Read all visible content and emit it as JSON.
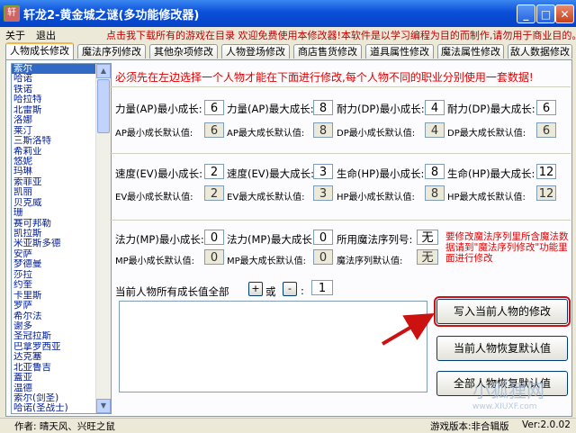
{
  "window": {
    "title": "轩龙2-黄金城之谜(多功能修改器)",
    "app_icon": "轩"
  },
  "menu": {
    "items": [
      "关于",
      "退出"
    ],
    "marquee": "点击我下载所有的游戏在目录 欢迎免费使用本修改器!本软件是以学习编程为目的而制作,请勿用于商业目的。"
  },
  "tabs": [
    "人物成长修改",
    "魔法序列修改",
    "其他杂项修改",
    "人物登场修改",
    "商店售货修改",
    "道具属性修改",
    "魔法属性修改",
    "敌人数据修改"
  ],
  "characters": [
    "索尔",
    "哈诺",
    "铁诺",
    "哈拉特",
    "北雷斯",
    "洛娜",
    "莱汀",
    "三斯洛特",
    "希莉业",
    "悠妮",
    "玛琳",
    "索菲亚",
    "凯丽",
    "贝克威",
    "珊",
    "赛可邦勒",
    "凯拉斯",
    "米亚斯多德",
    "安萨",
    "梦德曼",
    "莎拉",
    "约奎",
    "卡里斯",
    "罗萨",
    "希尔法",
    "谢多",
    "圣冠拉斯",
    "巴拿罗西亚",
    "达克塞",
    "北亚鲁吉",
    "蓋亚",
    "温德",
    "索尔(剑圣)",
    "哈诺(圣战士)"
  ],
  "notice": "必须先在左边选择一个人物才能在下面进行修改,每个人物不同的职业分别使用一套数据!",
  "strength": {
    "min_label": "力量(AP)最小成长:",
    "min": "6",
    "max_label": "力量(AP)最大成长:",
    "max": "8",
    "dmin_label": "耐力(DP)最小成长:",
    "dmin": "4",
    "dmax_label": "耐力(DP)最大成长:",
    "dmax": "6",
    "def_min_label": "AP最小成长默认值:",
    "def_min": "6",
    "def_max_label": "AP最大成长默认值:",
    "def_max": "8",
    "def_dmin_label": "DP最小成长默认值:",
    "def_dmin": "4",
    "def_dmax_label": "DP最大成长默认值:",
    "def_dmax": "6"
  },
  "speed": {
    "min_label": "速度(EV)最小成长:",
    "min": "2",
    "max_label": "速度(EV)最大成长:",
    "max": "3",
    "hmin_label": "生命(HP)最小成长:",
    "hmin": "8",
    "hmax_label": "生命(HP)最大成长:",
    "hmax": "12",
    "def_min_label": "EV最小成长默认值:",
    "def_min": "2",
    "def_max_label": "EV最大成长默认值:",
    "def_max": "3",
    "def_hmin_label": "HP最小成长默认值:",
    "def_hmin": "8",
    "def_hmax_label": "HP最大成长默认值:",
    "def_hmax": "12"
  },
  "magic": {
    "min_label": "法力(MP)最小成长:",
    "min": "0",
    "max_label": "法力(MP)最大成长:",
    "max": "0",
    "seq_label": "所用魔法序列号:",
    "seq": "无",
    "def_min_label": "MP最小成长默认值:",
    "def_min": "0",
    "def_max_label": "MP最大成长默认值:",
    "def_max": "0",
    "def_seq_label": "魔法序列默认值:",
    "def_seq": "无",
    "warning": "要修改魔法序列里所含魔法数据请到\"魔法序列修改\"功能里面进行修改"
  },
  "all": {
    "label": "当前人物所有成长值全部",
    "plus": "+",
    "or": "或",
    "minus": "-",
    "colon": ":",
    "value": "1"
  },
  "buttons": {
    "write": "写入当前人物的修改",
    "restore_current": "当前人物恢复默认值",
    "restore_all": "全部人物恢复默认值"
  },
  "status": {
    "author": "作者: 晴天风、兴旺之鼠",
    "version_label": "游戏版本:非合辑版",
    "version": "Ver:2.0.02"
  },
  "watermark": {
    "text": "小狐狸网",
    "url": "www.XIUXF.com"
  },
  "colors": {
    "title_bar": "#0a4fd8",
    "notice": "#e00000",
    "list_text": "#001c99",
    "selected": "#316ac5",
    "arrow": "#cc1111"
  }
}
